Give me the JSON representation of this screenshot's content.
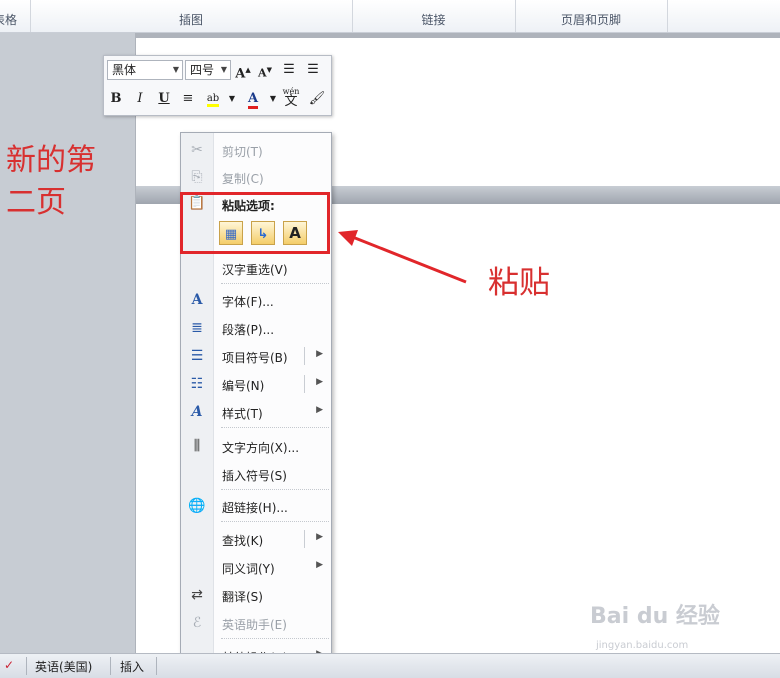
{
  "ribbon": {
    "groups": [
      "表格",
      "插图",
      "链接",
      "页眉和页脚"
    ]
  },
  "annotations": {
    "left_line1": "新的第",
    "left_line2": "二页",
    "right": "粘贴"
  },
  "mini_toolbar": {
    "font": "黑体",
    "size": "四号",
    "grow_font": "A",
    "shrink_font": "A",
    "bold": "B",
    "italic": "I",
    "underline": "U",
    "font_color": "A",
    "phonetic": "wén"
  },
  "context_menu": {
    "cut": "剪切(T)",
    "copy": "复制(C)",
    "paste_options": "粘贴选项:",
    "paste_text_only": "A",
    "reconvert": "汉字重选(V)",
    "font": "字体(F)...",
    "paragraph": "段落(P)...",
    "bullets": "项目符号(B)",
    "numbering": "编号(N)",
    "styles": "样式(T)",
    "text_direction": "文字方向(X)...",
    "insert_symbol": "插入符号(S)",
    "hyperlink": "超链接(H)...",
    "lookup": "查找(K)",
    "synonyms": "同义词(Y)",
    "translate": "翻译(S)",
    "english_assistant": "英语助手(E)",
    "other_actions": "其他操作(A)"
  },
  "status_bar": {
    "language": "英语(美国)",
    "mode": "插入"
  },
  "watermark": {
    "brand": "Bai du 经验",
    "url": "jingyan.baidu.com"
  },
  "colors": {
    "annotation_red": "#d83030",
    "highlight_box": "#e1262a"
  }
}
